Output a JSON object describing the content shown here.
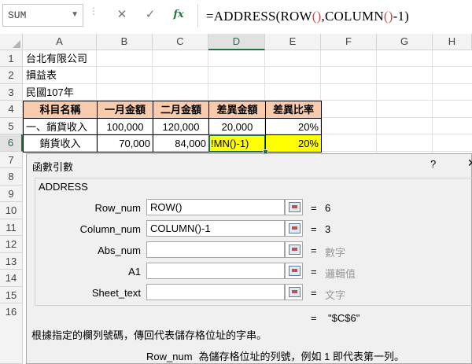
{
  "formula_bar": {
    "name_box": "SUM",
    "cancel_icon": "✕",
    "enter_icon": "✓",
    "fx_label": "fx",
    "formula_parts": [
      "=ADDRESS(ROW",
      "()",
      ",COLUMN",
      "()",
      "-1)"
    ]
  },
  "columns": [
    "A",
    "B",
    "C",
    "D",
    "E",
    "F",
    "G",
    "H"
  ],
  "selected_column": "D",
  "rows": [
    "1",
    "2",
    "3",
    "4",
    "5",
    "6",
    "7",
    "8",
    "9",
    "10",
    "11",
    "12",
    "13",
    "14",
    "15",
    "16"
  ],
  "selected_row": "6",
  "sheet": {
    "a1": "台北有限公司",
    "a2": "損益表",
    "a3": "民國107年",
    "headers": [
      "科目名稱",
      "一月金額",
      "二月金額",
      "差異金額",
      "差異比率"
    ],
    "row5": [
      "一、銷貨收入",
      "100,000",
      "120,000",
      "20,000",
      "20%"
    ],
    "row6": [
      "銷貨收入",
      "70,000",
      "84,000",
      "!MN()-1)",
      "20%"
    ]
  },
  "dialog": {
    "title": "函數引數",
    "help": "?",
    "close": "✕",
    "function_name": "ADDRESS",
    "args": [
      {
        "label": "Row_num",
        "value": "ROW()",
        "result": "6",
        "hint": false
      },
      {
        "label": "Column_num",
        "value": "COLUMN()-1",
        "result": "3",
        "hint": false
      },
      {
        "label": "Abs_num",
        "value": "",
        "result": "數字",
        "hint": true
      },
      {
        "label": "A1",
        "value": "",
        "result": "邏輯值",
        "hint": true
      },
      {
        "label": "Sheet_text",
        "value": "",
        "result": "文字",
        "hint": true
      }
    ],
    "eq": "=",
    "result_eq": "=",
    "result": "\"$C$6\"",
    "description": "根據指定的欄列號碼，傳回代表儲存格位址的字串。",
    "arg_help_name": "Row_num",
    "arg_help_text": "為儲存格位址的列號，例如 1 即代表第一列。"
  }
}
